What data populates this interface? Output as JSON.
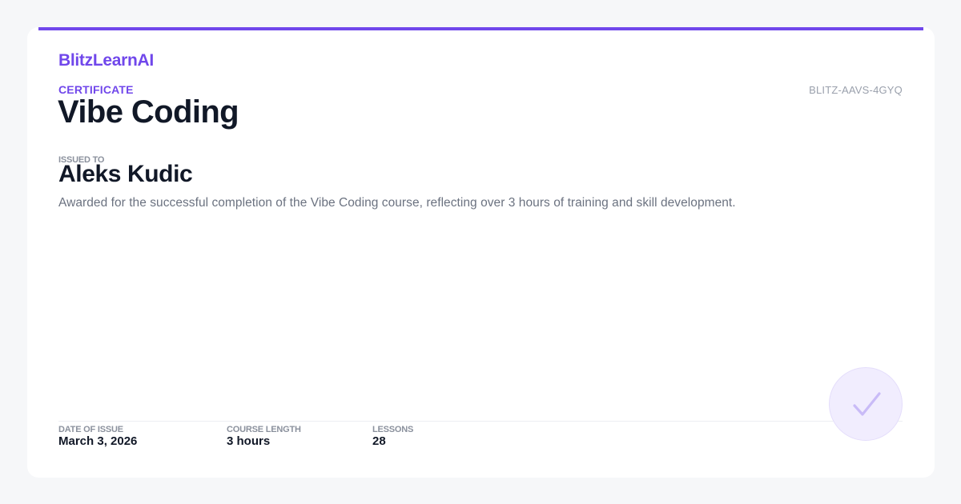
{
  "brand": {
    "name": "BlitzLearnAI",
    "accent_color": "#7047eb"
  },
  "certificate": {
    "label": "CERTIFICATE",
    "id": "BLITZ-AAVS-4GYQ",
    "course_title": "Vibe Coding",
    "issued_to_label": "ISSUED TO",
    "recipient": "Aleks Kudic",
    "description": "Awarded for the successful completion of the Vibe Coding course, reflecting over 3 hours of training and skill development."
  },
  "details": [
    {
      "label": "DATE OF ISSUE",
      "value": "March 3, 2026"
    },
    {
      "label": "COURSE LENGTH",
      "value": "3 hours"
    },
    {
      "label": "LESSONS",
      "value": "28"
    }
  ],
  "seal": {
    "icon": "checkmark-icon",
    "color": "#c9bbf7"
  }
}
